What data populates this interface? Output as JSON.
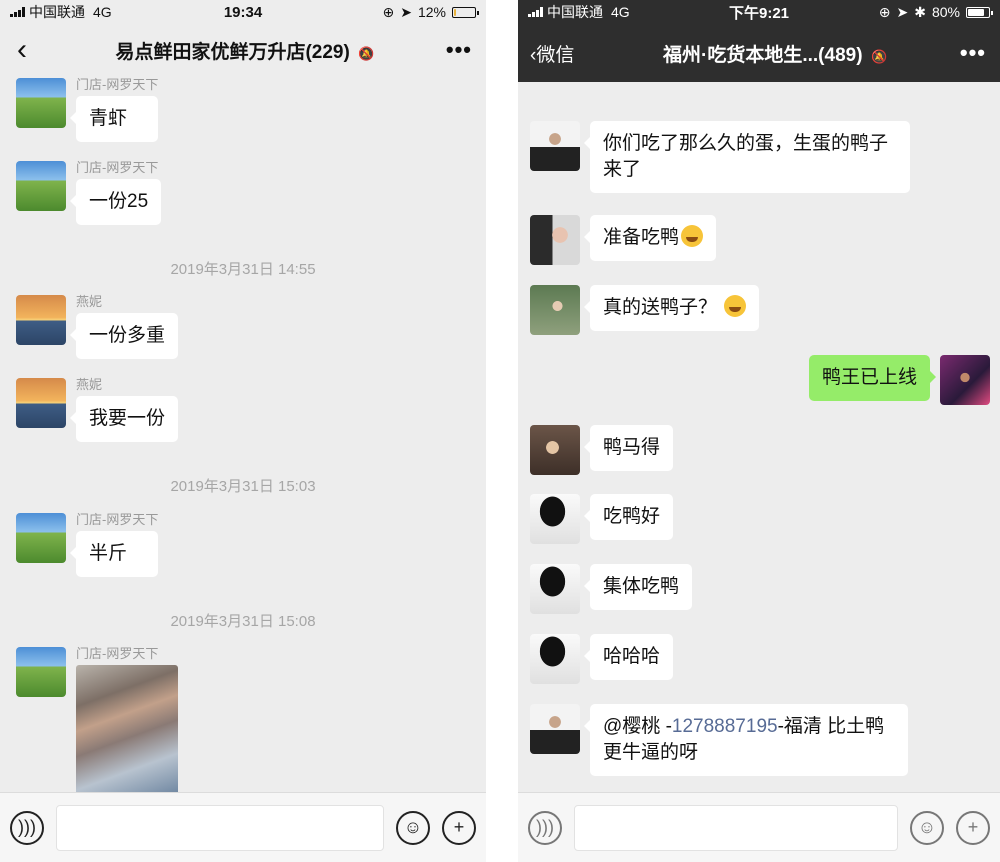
{
  "left": {
    "status": {
      "carrier": "中国联通",
      "network": "4G",
      "time": "19:34",
      "battery": "12%"
    },
    "nav": {
      "back": "‹",
      "title": "易点鲜田家优鲜万升店(229)",
      "more": "•••"
    },
    "messages": [
      {
        "sender": "门店-网罗天下",
        "text": "青虾"
      },
      {
        "sender": "门店-网罗天下",
        "text": "一份25"
      },
      {
        "sender": "燕妮",
        "text": "一份多重"
      },
      {
        "sender": "燕妮",
        "text": "我要一份"
      },
      {
        "sender": "门店-网罗天下",
        "text": "半斤"
      },
      {
        "sender": "门店-网罗天下",
        "image": "photo"
      }
    ],
    "times": [
      "2019年3月31日 14:55",
      "2019年3月31日 15:03",
      "2019年3月31日 15:08"
    ]
  },
  "right": {
    "status": {
      "carrier": "中国联通",
      "network": "4G",
      "time": "下午9:21",
      "battery": "80%"
    },
    "nav": {
      "back": "‹微信",
      "title": "福州·吃货本地生...(489)",
      "more": "•••"
    },
    "messages": [
      {
        "text": "你们吃了那么久的蛋，生蛋的鸭子来了"
      },
      {
        "text": "准备吃鸭"
      },
      {
        "text": "真的送鸭子？"
      },
      {
        "text": "鸭王已上线",
        "mine": true
      },
      {
        "text": "鸭马得"
      },
      {
        "text": "吃鸭好"
      },
      {
        "text": "集体吃鸭"
      },
      {
        "text": "哈哈哈"
      },
      {
        "text_prefix": "@樱桃 -",
        "mention": "1278887195",
        "text_suffix": "-福清 比土鸭更牛逼的呀"
      }
    ]
  },
  "colors": {
    "bubble_mine": "#95ec69",
    "mention": "#576b95",
    "nav_dark": "#2e2e2e"
  }
}
